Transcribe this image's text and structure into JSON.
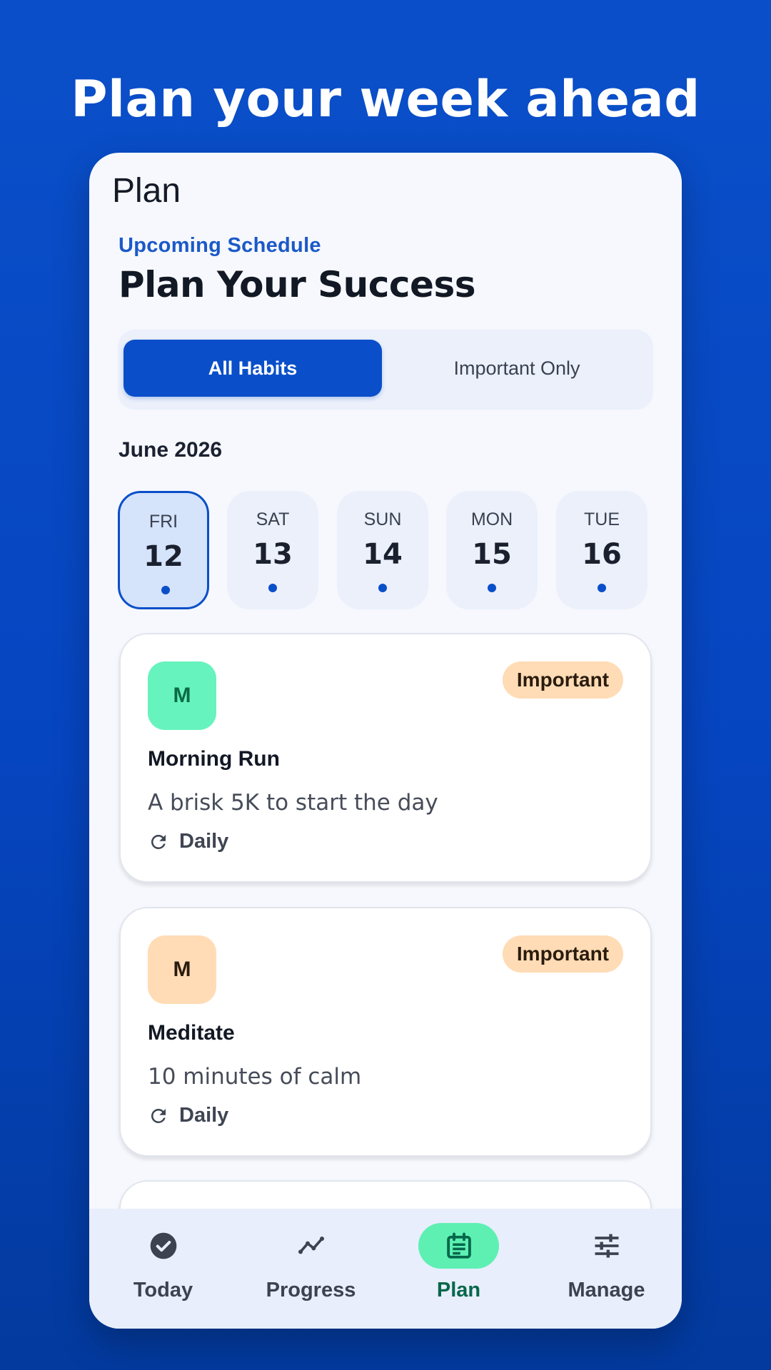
{
  "headline": "Plan your week ahead",
  "app": {
    "title": "Plan",
    "eyebrow": "Upcoming Schedule",
    "heading": "Plan Your Success"
  },
  "filter": {
    "options": [
      "All Habits",
      "Important Only"
    ],
    "selected": "All Habits"
  },
  "calendar": {
    "month": "June 2026",
    "days": [
      {
        "name": "FRI",
        "num": "12",
        "selected": true
      },
      {
        "name": "SAT",
        "num": "13",
        "selected": false
      },
      {
        "name": "SUN",
        "num": "14",
        "selected": false
      },
      {
        "name": "MON",
        "num": "15",
        "selected": false
      },
      {
        "name": "TUE",
        "num": "16",
        "selected": false
      }
    ]
  },
  "habits": [
    {
      "initial": "M",
      "badge": "Important",
      "title": "Morning Run",
      "desc": "A brisk 5K to start the day",
      "freq": "Daily",
      "avatar_color": "#66f3be",
      "avatar_text_color": "#0c6a45"
    },
    {
      "initial": "M",
      "badge": "Important",
      "title": "Meditate",
      "desc": "10 minutes of calm",
      "freq": "Daily",
      "avatar_color": "#ffdcb5",
      "avatar_text_color": "#2a1b0e"
    }
  ],
  "nav": [
    {
      "label": "Today",
      "icon": "check-circle-icon"
    },
    {
      "label": "Progress",
      "icon": "trend-line-icon"
    },
    {
      "label": "Plan",
      "icon": "calendar-icon",
      "active": true
    },
    {
      "label": "Manage",
      "icon": "sliders-icon"
    }
  ],
  "colors": {
    "primary": "#0a4fc9",
    "accent_green": "#5ef0b3",
    "badge_bg": "#ffdcb5"
  }
}
